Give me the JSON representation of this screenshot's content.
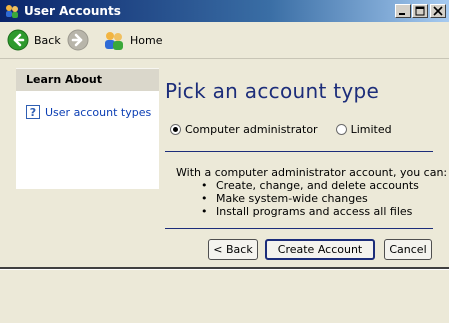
{
  "window": {
    "title": "User Accounts",
    "controls": [
      "minimize",
      "maximize",
      "close"
    ]
  },
  "toolbar": {
    "back_label": "Back",
    "home_label": "Home"
  },
  "sidebar": {
    "heading": "Learn About",
    "links": [
      {
        "label": "User account types",
        "icon": "help-icon"
      }
    ]
  },
  "main": {
    "title": "Pick an account type",
    "options": [
      {
        "label": "Computer administrator",
        "selected": true
      },
      {
        "label": "Limited",
        "selected": false
      }
    ],
    "description": "With a computer administrator account, you can:",
    "bullets": [
      "Create, change, and delete accounts",
      "Make system-wide changes",
      "Install programs and access all files"
    ]
  },
  "buttons": {
    "back": "< Back",
    "create": "Create Account",
    "cancel": "Cancel"
  },
  "colors": {
    "title_blue": "#1c2d7a",
    "link_blue": "#0b3eb4",
    "back_green": "#2e9a2e"
  }
}
